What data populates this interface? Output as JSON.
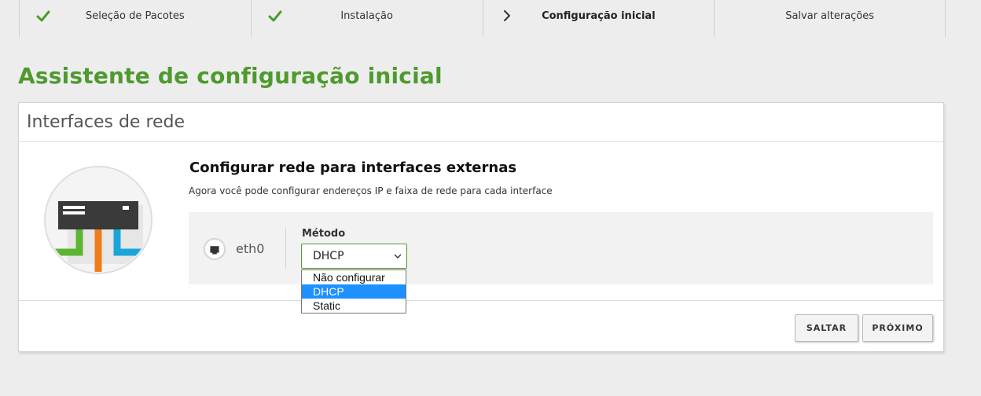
{
  "steps": [
    {
      "label": "Seleção de Pacotes",
      "status": "done"
    },
    {
      "label": "Instalação",
      "status": "done"
    },
    {
      "label": "Configuração inicial",
      "status": "current"
    },
    {
      "label": "Salvar alterações",
      "status": "pending"
    }
  ],
  "page": {
    "title": "Assistente de configuração inicial"
  },
  "panel": {
    "header": "Interfaces de rede",
    "section_title": "Configurar rede para interfaces externas",
    "section_desc": "Agora você pode configurar endereços IP e faixa de rede para cada interface"
  },
  "interface": {
    "name": "eth0",
    "method_label": "Método",
    "method_value": "DHCP",
    "options": [
      "Não configurar",
      "DHCP",
      "Static"
    ],
    "selected_option": "DHCP"
  },
  "buttons": {
    "skip": "SALTAR",
    "next": "PRÓXIMO"
  },
  "colors": {
    "accent": "#4e9a2e",
    "selected_option": "#1e90ff",
    "cable_green": "#5cb531",
    "cable_orange": "#f07d1a",
    "cable_blue": "#1aa5d8"
  },
  "icons": {
    "done": "check-icon",
    "current": "chevron-right-icon",
    "interface": "ethernet-port-icon",
    "select": "chevron-down-icon"
  }
}
